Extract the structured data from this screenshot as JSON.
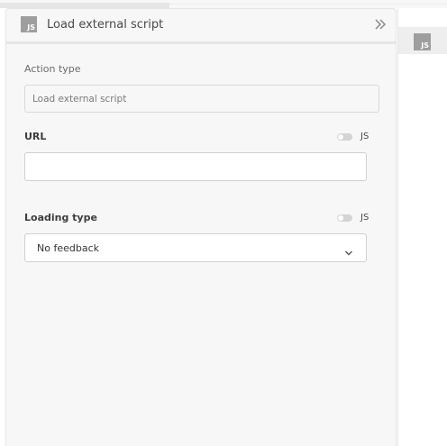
{
  "panel": {
    "title": "Load external script",
    "icon_text": "JS"
  },
  "fields": {
    "action_type": {
      "label": "Action type",
      "value": "Load external script"
    },
    "url": {
      "label": "URL",
      "value": "",
      "js_toggle_label": "JS",
      "js_enabled": false
    },
    "loading_type": {
      "label": "Loading type",
      "selected": "No feedback",
      "js_toggle_label": "JS",
      "js_enabled": false
    }
  },
  "side_panel": {
    "icon_text": "JS"
  },
  "colors": {
    "panel_bg": "#f7f7f7",
    "icon_bg": "#9e9e9e",
    "border": "#d0d0d0"
  }
}
